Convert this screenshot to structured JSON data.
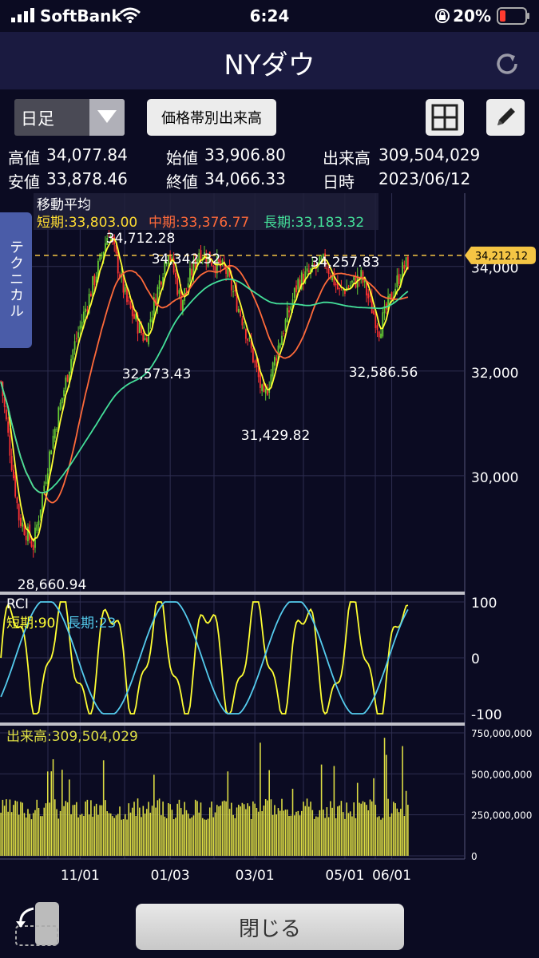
{
  "status": {
    "carrier": "SoftBank",
    "time": "6:24",
    "battery": "20%"
  },
  "nav": {
    "title": "NYダウ"
  },
  "toolbar": {
    "period": "日足",
    "volume_at_price": "価格帯別出来高"
  },
  "price_info": {
    "high_label": "高値",
    "high": "34,077.84",
    "open_label": "始値",
    "open": "33,906.80",
    "volume_label": "出来高",
    "volume": "309,504,029",
    "low_label": "安値",
    "low": "33,878.46",
    "close_label": "終値",
    "close": "34,066.33",
    "date_label": "日時",
    "date": "2023/06/12"
  },
  "side_tab": "テクニカル",
  "bottom": {
    "close": "閉じる"
  },
  "colors": {
    "background": "#0b0b22",
    "short": "#ffff33",
    "mid": "#ff6a3a",
    "long": "#44e09a",
    "rci_long": "#55ccee",
    "up_candle": "#66cc33",
    "down_candle": "#ff3333",
    "volume": "#dddd44",
    "last_price": "#f5c544"
  },
  "chart_data": {
    "type": "candlestick",
    "main": {
      "legend_title": "移動平均",
      "legend": [
        {
          "name": "短期:33,803.00",
          "color": "#ffdd33"
        },
        {
          "name": "中期:33,376.77",
          "color": "#ff6a3a"
        },
        {
          "name": "長期:33,183.32",
          "color": "#44e09a"
        }
      ],
      "ylim": [
        27800,
        35400
      ],
      "y_ticks": [
        30000,
        32000,
        34000
      ],
      "y_tick_labels": [
        "30,000",
        "32,000",
        "34,000"
      ],
      "last_price": 34212.12,
      "last_price_label": "34,212.12",
      "annotations": [
        {
          "label": "34,712.28",
          "value": 34712.28
        },
        {
          "label": "34,342.32",
          "value": 34342.32
        },
        {
          "label": "34,257.83",
          "value": 34257.83
        },
        {
          "label": "32,573.43",
          "value": 32573.43
        },
        {
          "label": "32,586.56",
          "value": 32586.56
        },
        {
          "label": "31,429.82",
          "value": 31429.82
        },
        {
          "label": "28,660.94",
          "value": 28660.94
        }
      ],
      "anchors": [
        [
          0,
          31800
        ],
        [
          10,
          29200
        ],
        [
          18,
          28660
        ],
        [
          28,
          30600
        ],
        [
          40,
          32400
        ],
        [
          55,
          34100
        ],
        [
          60,
          34700
        ],
        [
          70,
          33300
        ],
        [
          80,
          32600
        ],
        [
          88,
          33700
        ],
        [
          93,
          34342
        ],
        [
          100,
          33300
        ],
        [
          110,
          34300
        ],
        [
          125,
          33900
        ],
        [
          135,
          32900
        ],
        [
          142,
          32000
        ],
        [
          146,
          31430
        ],
        [
          155,
          32600
        ],
        [
          165,
          33700
        ],
        [
          180,
          34100
        ],
        [
          188,
          33500
        ],
        [
          200,
          33800
        ],
        [
          210,
          32800
        ],
        [
          222,
          33900
        ],
        [
          226,
          34070
        ]
      ]
    },
    "rci": {
      "title": "RCI",
      "legend": [
        {
          "name": "短期:90",
          "color": "#ffff33"
        },
        {
          "name": "長期:23",
          "color": "#55ccee"
        }
      ],
      "ylim": [
        -100,
        100
      ],
      "y_ticks": [
        100,
        0,
        -100
      ],
      "y_tick_labels": [
        "100",
        "0",
        "-100"
      ]
    },
    "volume": {
      "title": "出来高:309,504,029",
      "ylim": [
        0,
        750000000
      ],
      "y_ticks": [
        750000000,
        500000000,
        250000000,
        0
      ],
      "y_tick_labels": [
        "750,000,000",
        "500,000,000",
        "250,000,000",
        "0"
      ]
    },
    "x_labels": [
      {
        "label": "11/01",
        "index": 44
      },
      {
        "label": "01/03",
        "index": 94
      },
      {
        "label": "03/01",
        "index": 141
      },
      {
        "label": "05/01",
        "index": 191
      },
      {
        "label": "06/01",
        "index": 217
      }
    ],
    "n_bars": 227
  }
}
